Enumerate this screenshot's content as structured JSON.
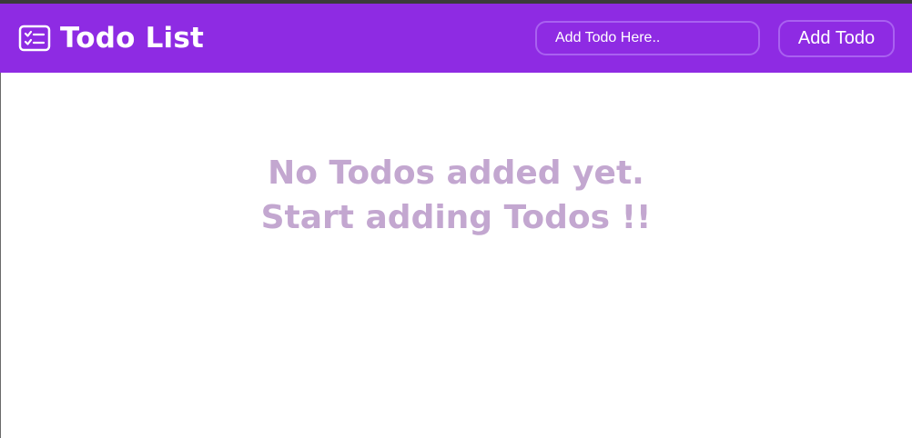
{
  "colors": {
    "header_background": "#8e2be3",
    "control_border": "#a961f0",
    "empty_message_text": "#c3a7d0",
    "page_background": "#ffffff"
  },
  "header": {
    "icon": "checklist-icon",
    "title": "Todo List",
    "input": {
      "value": "",
      "placeholder": "Add Todo Here.."
    },
    "add_button_label": "Add Todo"
  },
  "main": {
    "empty_message": {
      "line1": "No Todos added yet.",
      "line2": "Start adding Todos !!"
    }
  }
}
